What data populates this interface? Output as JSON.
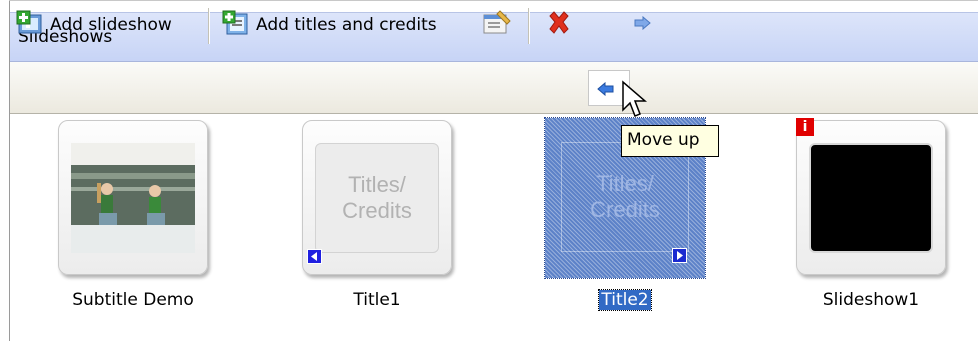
{
  "panel": {
    "title": "Slideshows"
  },
  "toolbar": {
    "add_slideshow": "Add slideshow",
    "add_titles": "Add titles and credits"
  },
  "tooltip": "Move up",
  "thumbnails": [
    {
      "caption": "Subtitle Demo",
      "kind": "video"
    },
    {
      "caption": "Title1",
      "kind": "titles",
      "line1": "Titles/",
      "line2": "Credits",
      "marker": "left"
    },
    {
      "caption": "Title2",
      "kind": "titles",
      "line1": "Titles/",
      "line2": "Credits",
      "marker": "right",
      "selected": true
    },
    {
      "caption": "Slideshow1",
      "kind": "black",
      "badge": "i"
    }
  ],
  "colors": {
    "selection": "#316ac5",
    "delete": "#e0301e",
    "arrow": "#3b7be0",
    "badge": "#e00000"
  }
}
